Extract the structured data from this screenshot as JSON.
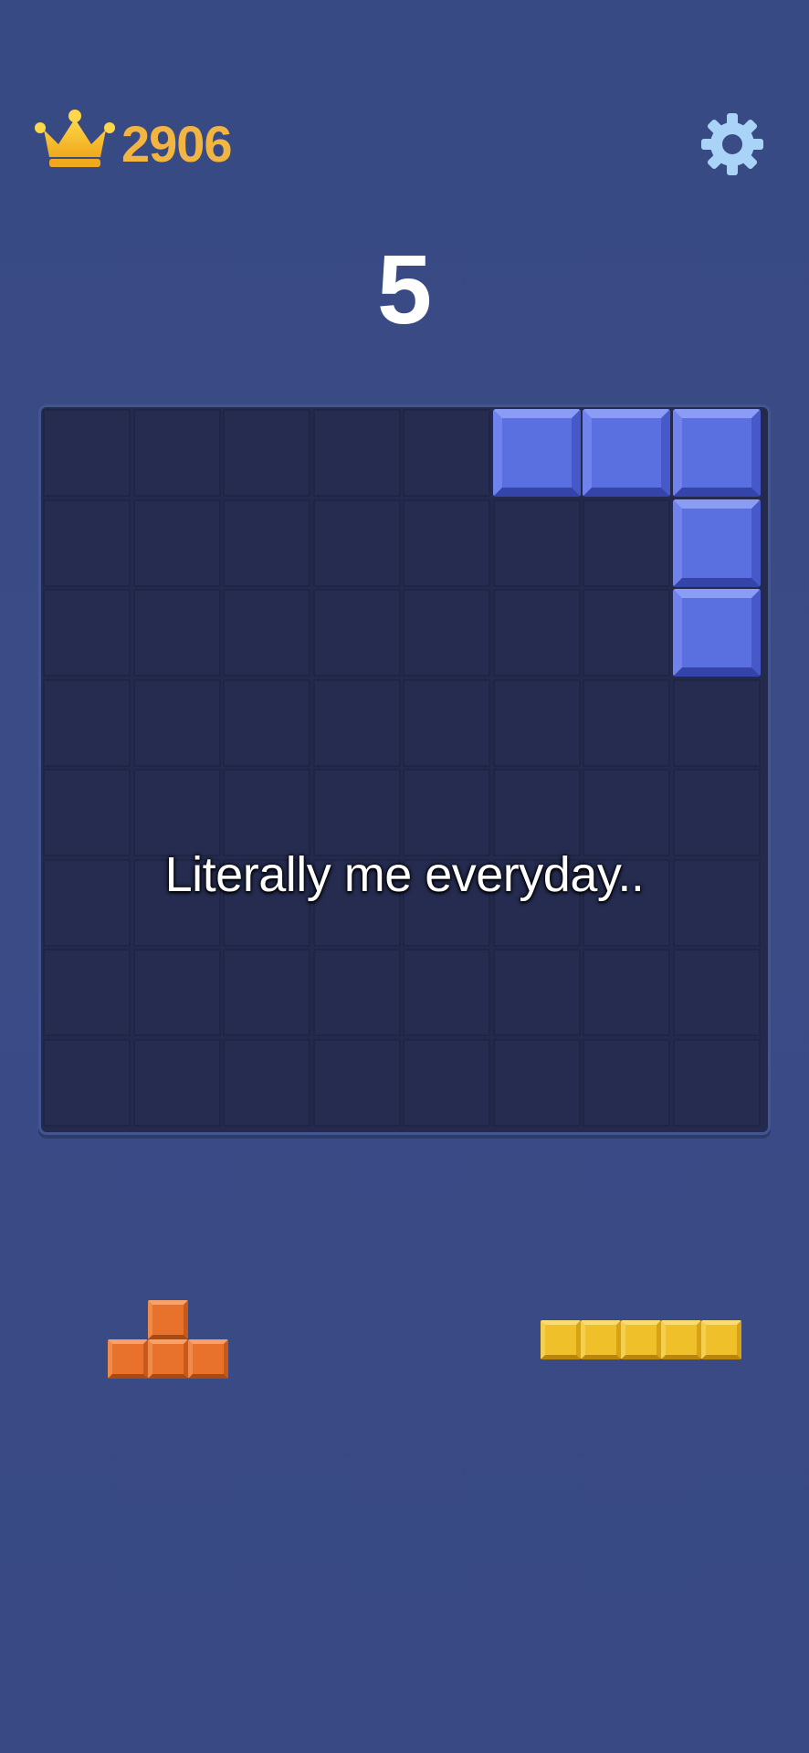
{
  "header": {
    "best_score": "2906",
    "current_score": "5",
    "crown_icon": "crown-icon",
    "settings_icon": "gear-icon"
  },
  "board": {
    "rows": 8,
    "cols": 8,
    "filled_cells": [
      {
        "row": 0,
        "col": 5,
        "color": "blue"
      },
      {
        "row": 0,
        "col": 6,
        "color": "blue"
      },
      {
        "row": 0,
        "col": 7,
        "color": "blue"
      },
      {
        "row": 1,
        "col": 7,
        "color": "blue"
      },
      {
        "row": 2,
        "col": 7,
        "color": "blue"
      }
    ]
  },
  "caption": "Literally me everyday..",
  "tray": {
    "pieces": [
      {
        "name": "t-piece",
        "color": "orange",
        "cells": [
          [
            0,
            1
          ],
          [
            1,
            0
          ],
          [
            1,
            1
          ],
          [
            1,
            2
          ]
        ]
      },
      {
        "name": "i5-piece",
        "color": "yellow",
        "cells": [
          [
            0,
            0
          ],
          [
            0,
            1
          ],
          [
            0,
            2
          ],
          [
            0,
            3
          ],
          [
            0,
            4
          ]
        ]
      }
    ]
  },
  "colors": {
    "background": "#3a4b86",
    "board": "#232a4e",
    "blue": "#5a6fe0",
    "orange": "#e8722c",
    "yellow": "#f0c02a",
    "score_gold": "#f3b542",
    "settings": "#a9d4f7"
  }
}
